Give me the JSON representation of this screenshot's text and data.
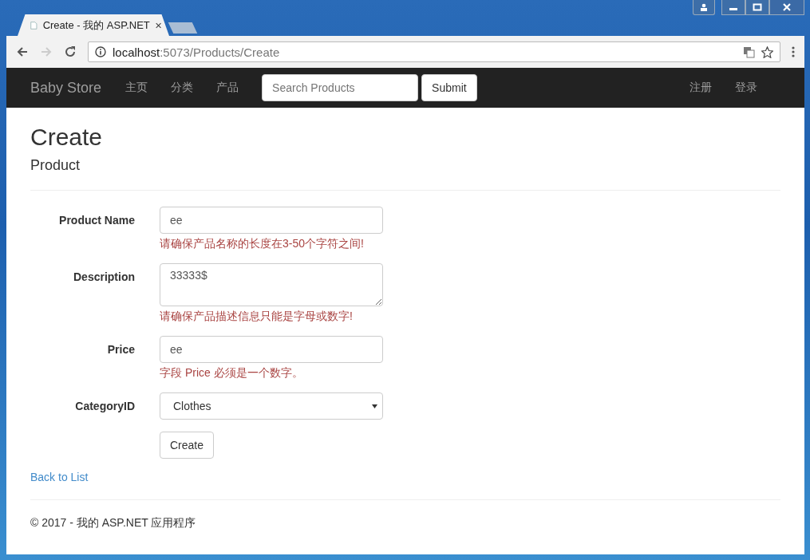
{
  "browser": {
    "tabs": [
      {
        "title": "Create - 我的 ASP.NET",
        "selected": true
      },
      {
        "selected": false
      }
    ],
    "url": {
      "host": "localhost",
      "path": ":5073/Products/Create"
    }
  },
  "navbar": {
    "brand": "Baby Store",
    "links": [
      "主页",
      "分类",
      "产品"
    ],
    "search": {
      "placeholder": "Search Products"
    },
    "submit": "Submit",
    "right_links": [
      "注册",
      "登录"
    ]
  },
  "page": {
    "title": "Create",
    "subtitle": "Product"
  },
  "form": {
    "fields": [
      {
        "label": "Product Name",
        "kind": "input",
        "value": "ee",
        "error": "请确保产品名称的长度在3-50个字符之间!"
      },
      {
        "label": "Description",
        "kind": "textarea",
        "value": "33333$",
        "error": "请确保产品描述信息只能是字母或数字!"
      },
      {
        "label": "Price",
        "kind": "input",
        "value": "ee",
        "error": "字段 Price 必须是一个数字。"
      },
      {
        "label": "CategoryID",
        "kind": "select",
        "value": "Clothes"
      }
    ],
    "button": "Create"
  },
  "back_link": "Back to List",
  "footer": "© 2017 - 我的 ASP.NET 应用程序"
}
